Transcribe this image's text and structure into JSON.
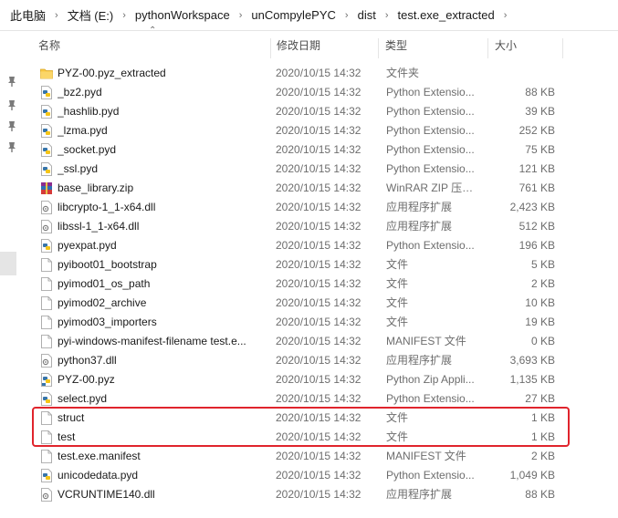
{
  "breadcrumb": [
    "此电脑",
    "文档 (E:)",
    "pythonWorkspace",
    "unCompylePYC",
    "dist",
    "test.exe_extracted"
  ],
  "columns": {
    "name": "名称",
    "date": "修改日期",
    "type": "类型",
    "size": "大小"
  },
  "files": [
    {
      "name": "PYZ-00.pyz_extracted",
      "date": "2020/10/15 14:32",
      "type": "文件夹",
      "size": "",
      "icon": "folder-icon"
    },
    {
      "name": "_bz2.pyd",
      "date": "2020/10/15 14:32",
      "type": "Python Extensio...",
      "size": "88 KB",
      "icon": "python-file-icon"
    },
    {
      "name": "_hashlib.pyd",
      "date": "2020/10/15 14:32",
      "type": "Python Extensio...",
      "size": "39 KB",
      "icon": "python-file-icon"
    },
    {
      "name": "_lzma.pyd",
      "date": "2020/10/15 14:32",
      "type": "Python Extensio...",
      "size": "252 KB",
      "icon": "python-file-icon"
    },
    {
      "name": "_socket.pyd",
      "date": "2020/10/15 14:32",
      "type": "Python Extensio...",
      "size": "75 KB",
      "icon": "python-file-icon"
    },
    {
      "name": "_ssl.pyd",
      "date": "2020/10/15 14:32",
      "type": "Python Extensio...",
      "size": "121 KB",
      "icon": "python-file-icon"
    },
    {
      "name": "base_library.zip",
      "date": "2020/10/15 14:32",
      "type": "WinRAR ZIP 压缩...",
      "size": "761 KB",
      "icon": "winrar-archive-icon"
    },
    {
      "name": "libcrypto-1_1-x64.dll",
      "date": "2020/10/15 14:32",
      "type": "应用程序扩展",
      "size": "2,423 KB",
      "icon": "dll-file-icon"
    },
    {
      "name": "libssl-1_1-x64.dll",
      "date": "2020/10/15 14:32",
      "type": "应用程序扩展",
      "size": "512 KB",
      "icon": "dll-file-icon"
    },
    {
      "name": "pyexpat.pyd",
      "date": "2020/10/15 14:32",
      "type": "Python Extensio...",
      "size": "196 KB",
      "icon": "python-file-icon"
    },
    {
      "name": "pyiboot01_bootstrap",
      "date": "2020/10/15 14:32",
      "type": "文件",
      "size": "5 KB",
      "icon": "blank-file-icon"
    },
    {
      "name": "pyimod01_os_path",
      "date": "2020/10/15 14:32",
      "type": "文件",
      "size": "2 KB",
      "icon": "blank-file-icon"
    },
    {
      "name": "pyimod02_archive",
      "date": "2020/10/15 14:32",
      "type": "文件",
      "size": "10 KB",
      "icon": "blank-file-icon"
    },
    {
      "name": "pyimod03_importers",
      "date": "2020/10/15 14:32",
      "type": "文件",
      "size": "19 KB",
      "icon": "blank-file-icon"
    },
    {
      "name": "pyi-windows-manifest-filename test.e...",
      "date": "2020/10/15 14:32",
      "type": "MANIFEST 文件",
      "size": "0 KB",
      "icon": "blank-file-icon"
    },
    {
      "name": "python37.dll",
      "date": "2020/10/15 14:32",
      "type": "应用程序扩展",
      "size": "3,693 KB",
      "icon": "dll-file-icon"
    },
    {
      "name": "PYZ-00.pyz",
      "date": "2020/10/15 14:32",
      "type": "Python Zip Appli...",
      "size": "1,135 KB",
      "icon": "python-zip-icon"
    },
    {
      "name": "select.pyd",
      "date": "2020/10/15 14:32",
      "type": "Python Extensio...",
      "size": "27 KB",
      "icon": "python-file-icon"
    },
    {
      "name": "struct",
      "date": "2020/10/15 14:32",
      "type": "文件",
      "size": "1 KB",
      "icon": "blank-file-icon"
    },
    {
      "name": "test",
      "date": "2020/10/15 14:32",
      "type": "文件",
      "size": "1 KB",
      "icon": "blank-file-icon"
    },
    {
      "name": "test.exe.manifest",
      "date": "2020/10/15 14:32",
      "type": "MANIFEST 文件",
      "size": "2 KB",
      "icon": "blank-file-icon"
    },
    {
      "name": "unicodedata.pyd",
      "date": "2020/10/15 14:32",
      "type": "Python Extensio...",
      "size": "1,049 KB",
      "icon": "python-file-icon"
    },
    {
      "name": "VCRUNTIME140.dll",
      "date": "2020/10/15 14:32",
      "type": "应用程序扩展",
      "size": "88 KB",
      "icon": "dll-file-icon"
    }
  ],
  "colors": {
    "highlight": "#e0242c",
    "folder": "#f8c845",
    "python_blue": "#3775aa",
    "python_yellow": "#f5c518"
  }
}
